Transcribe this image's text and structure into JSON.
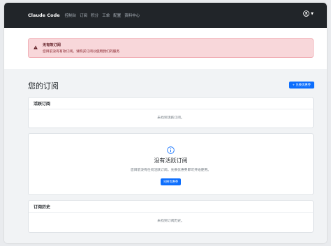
{
  "navbar": {
    "brand": "Claude Code",
    "links": [
      "控制台",
      "订阅",
      "积分",
      "工单",
      "配置",
      "资料中心"
    ]
  },
  "alert": {
    "title": "无有效订阅",
    "text": "您目前没有有效订阅。请购买订阅以使用我们的服务"
  },
  "page": {
    "title": "您的订阅",
    "redeem_button": "+ 兑换优惠券"
  },
  "active_card": {
    "title": "活跃订阅",
    "empty_text": "未找到活跃订阅。"
  },
  "empty_state": {
    "title": "没有活跃订阅",
    "text": "您目前没有任何活跃订阅。兑换优惠券即可开始使用。",
    "button": "兑换优惠券"
  },
  "history_card": {
    "title": "订阅历史",
    "empty_text": "未找到订阅历史。"
  },
  "colors": {
    "navbar_bg": "#212529",
    "alert_bg": "#f8d7da",
    "primary": "#0d6efd",
    "page_bg": "#f1f3f5"
  },
  "icons": [
    "user-circle-icon",
    "caret-down-icon",
    "warning-triangle-icon",
    "info-circle-icon"
  ]
}
